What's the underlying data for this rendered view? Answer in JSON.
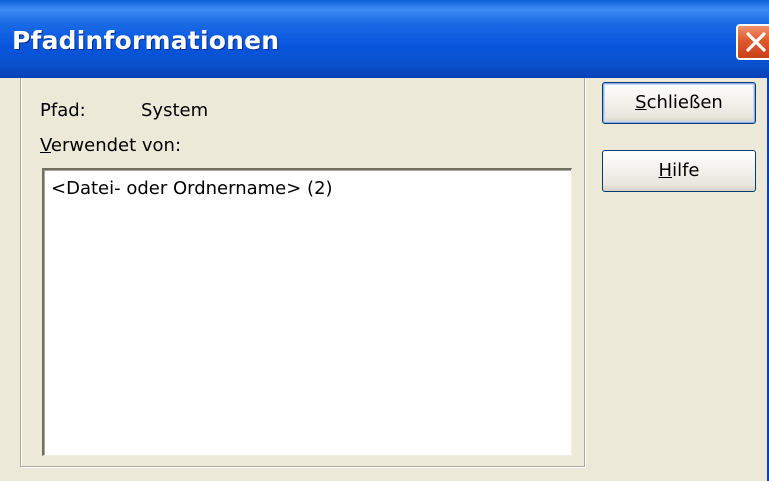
{
  "window": {
    "title": "Pfadinformationen"
  },
  "labels": {
    "path_label": "Pfad:",
    "path_value": "System",
    "used_by_accel": "V",
    "used_by_rest": "erwendet von:"
  },
  "list": {
    "items": [
      "<Datei- oder Ordnername> (2)"
    ]
  },
  "buttons": {
    "close_accel": "S",
    "close_rest": "chließen",
    "help_accel": "H",
    "help_rest": "ilfe"
  },
  "icons": {
    "close": "close-x-icon"
  },
  "colors": {
    "titlebar": "#0a55dd",
    "close_button": "#e05a2c",
    "dialog_bg": "#ece9d8"
  }
}
